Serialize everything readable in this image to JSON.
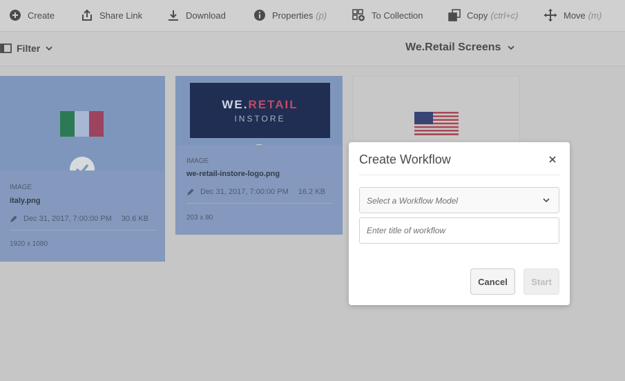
{
  "toolbar": {
    "items": [
      {
        "label": "Create",
        "icon": "plus-circle-icon",
        "shortcut": ""
      },
      {
        "label": "Share Link",
        "icon": "share-icon",
        "shortcut": ""
      },
      {
        "label": "Download",
        "icon": "download-icon",
        "shortcut": ""
      },
      {
        "label": "Properties",
        "icon": "info-icon",
        "shortcut": "(p)"
      },
      {
        "label": "To Collection",
        "icon": "collection-add-icon",
        "shortcut": ""
      },
      {
        "label": "Copy",
        "icon": "copy-icon",
        "shortcut": "(ctrl+c)"
      },
      {
        "label": "Move",
        "icon": "move-icon",
        "shortcut": "(m)"
      }
    ]
  },
  "filterbar": {
    "filter_label": "Filter",
    "folder_title": "We.Retail Screens"
  },
  "cards": [
    {
      "kind": "IMAGE",
      "filename": "italy.png",
      "modified": "Dec 31, 2017, 7:00:00 PM",
      "size": "30.6 KB",
      "dimensions": "1920 x 1080",
      "selected": true
    },
    {
      "kind": "IMAGE",
      "filename": "we-retail-instore-logo.png",
      "modified": "Dec 31, 2017, 7:00:00 PM",
      "size": "16.2 KB",
      "dimensions": "203 x 80",
      "selected": true,
      "thumb_text": {
        "brand_a": "WE.",
        "brand_b": "RETAIL",
        "sub": "INSTORE"
      }
    },
    {
      "selected": false
    }
  ],
  "dialog": {
    "title": "Create Workflow",
    "model_placeholder": "Select a Workflow Model",
    "title_placeholder": "Enter title of workflow",
    "title_value": "",
    "cancel_label": "Cancel",
    "start_label": "Start"
  },
  "colors": {
    "selection": "#8299bd",
    "logo_bg": "#1f2e52",
    "logo_accent": "#c24a6a"
  }
}
